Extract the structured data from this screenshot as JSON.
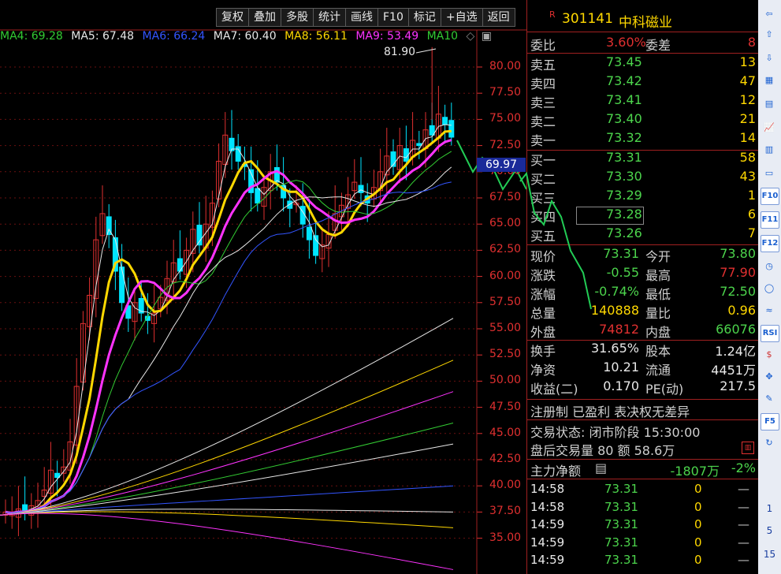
{
  "toolbar": {
    "buttons": [
      "复权",
      "叠加",
      "多股",
      "统计",
      "画线",
      "F10",
      "标记",
      "+自选",
      "返回"
    ]
  },
  "ma_legend": [
    {
      "label": "MA4: 69.28",
      "color": "#33cc33"
    },
    {
      "label": "MA5: 67.48",
      "color": "#e8e8e8"
    },
    {
      "label": "MA6: 66.24",
      "color": "#3355ff"
    },
    {
      "label": "MA7: 60.40",
      "color": "#e8e8e8"
    },
    {
      "label": "MA8: 56.11",
      "color": "#ffd800"
    },
    {
      "label": "MA9: 53.49",
      "color": "#ff33ff"
    },
    {
      "label": "MA10",
      "color": "#33cc33"
    }
  ],
  "chart": {
    "high_marker": "81.90",
    "last_price_tag": "69.97",
    "y_ticks": [
      "80.00",
      "77.50",
      "75.00",
      "72.50",
      "70.00",
      "67.50",
      "65.00",
      "62.50",
      "60.00",
      "57.50",
      "55.00",
      "52.50",
      "50.00",
      "47.50",
      "45.00",
      "42.50",
      "40.00",
      "37.50",
      "35.00"
    ],
    "y_min": 34.0,
    "y_max": 83.0,
    "colors": {
      "up": "#e03030",
      "down": "#00e5ff",
      "bg": "#000000"
    }
  },
  "stock": {
    "badge": "R",
    "code": "301141",
    "name": "中科磁业"
  },
  "ratio": {
    "label1": "委比",
    "value1": "3.60%",
    "label2": "委差",
    "value2": "8"
  },
  "asks": [
    {
      "label": "卖五",
      "price": "73.45",
      "vol": "13"
    },
    {
      "label": "卖四",
      "price": "73.42",
      "vol": "47"
    },
    {
      "label": "卖三",
      "price": "73.41",
      "vol": "12"
    },
    {
      "label": "卖二",
      "price": "73.40",
      "vol": "21"
    },
    {
      "label": "卖一",
      "price": "73.32",
      "vol": "14"
    }
  ],
  "bids": [
    {
      "label": "买一",
      "price": "73.31",
      "vol": "58"
    },
    {
      "label": "买二",
      "price": "73.30",
      "vol": "43"
    },
    {
      "label": "买三",
      "price": "73.29",
      "vol": "1"
    },
    {
      "label": "买四",
      "price": "73.28",
      "vol": "6"
    },
    {
      "label": "买五",
      "price": "73.26",
      "vol": "7"
    }
  ],
  "quote": [
    {
      "l1": "现价",
      "v1": "73.31",
      "c1": "green",
      "l2": "今开",
      "v2": "73.80",
      "c2": "green"
    },
    {
      "l1": "涨跌",
      "v1": "-0.55",
      "c1": "green",
      "l2": "最高",
      "v2": "77.90",
      "c2": "red"
    },
    {
      "l1": "涨幅",
      "v1": "-0.74%",
      "c1": "green",
      "l2": "最低",
      "v2": "72.50",
      "c2": "green"
    },
    {
      "l1": "总量",
      "v1": "140888",
      "c1": "yellow",
      "l2": "量比",
      "v2": "0.96",
      "c2": "yellow"
    },
    {
      "l1": "外盘",
      "v1": "74812",
      "c1": "red",
      "l2": "内盘",
      "v2": "66076",
      "c2": "green"
    }
  ],
  "fundamentals": [
    {
      "l1": "换手",
      "v1": "31.65%",
      "l2": "股本",
      "v2": "1.24亿"
    },
    {
      "l1": "净资",
      "v1": "10.21",
      "l2": "流通",
      "v2": "4451万"
    },
    {
      "l1": "收益(二)",
      "v1": "0.170",
      "l2": "PE(动)",
      "v2": "217.5"
    }
  ],
  "flags": "注册制 已盈利 表决权无差异",
  "trade_status": "交易状态: 闭市阶段 15:30:00",
  "after_hours": "盘后交易量 80 额 58.6万",
  "main_flow": {
    "label": "主力净额",
    "value": "-1807万",
    "pct": "-2%"
  },
  "ticks": [
    {
      "time": "14:58",
      "price": "73.31",
      "qty": "0",
      "dir": "—"
    },
    {
      "time": "14:58",
      "price": "73.31",
      "qty": "0",
      "dir": "—"
    },
    {
      "time": "14:59",
      "price": "73.31",
      "qty": "0",
      "dir": "—"
    },
    {
      "time": "14:59",
      "price": "73.31",
      "qty": "0",
      "dir": "—"
    },
    {
      "time": "14:59",
      "price": "73.31",
      "qty": "0",
      "dir": "—"
    }
  ],
  "side_icons": [
    "up-arrow",
    "home",
    "down-arrow",
    "grid",
    "list",
    "line-chart",
    "candle",
    "window",
    "F10",
    "F11",
    "F12",
    "clock",
    "circle",
    "wave",
    "RSI",
    "dollar",
    "move",
    "pen",
    "F5",
    "refresh"
  ],
  "side_numbers": [
    "1",
    "5",
    "15"
  ]
}
